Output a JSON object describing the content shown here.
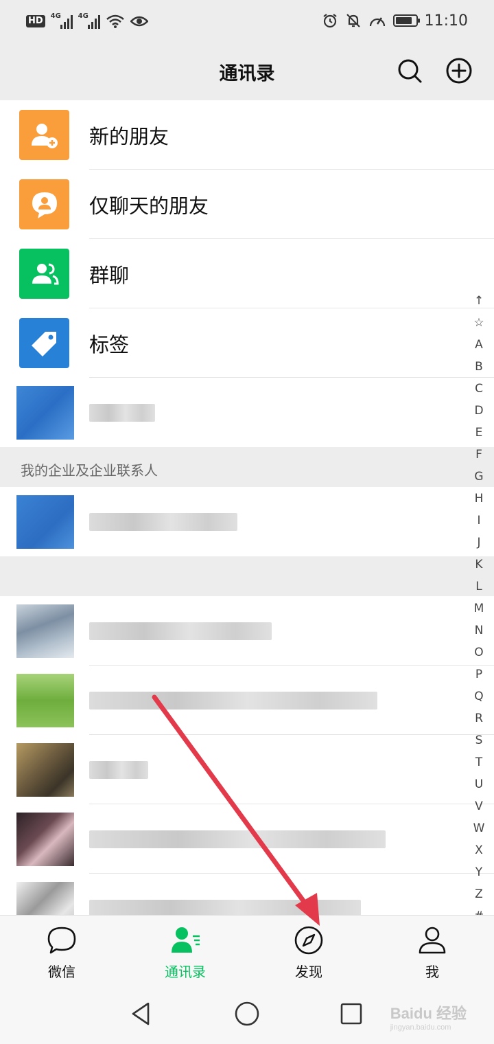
{
  "status_bar": {
    "hd": "HD",
    "network_1": "4G",
    "network_2": "4G",
    "time": "11:10",
    "battery_level": 0.85
  },
  "header": {
    "title": "通讯录",
    "search_icon": "search-icon",
    "add_icon": "plus-circle-icon"
  },
  "fixed_items": [
    {
      "label": "新的朋友",
      "icon": "person-add-icon",
      "color": "#fa9d3b"
    },
    {
      "label": "仅聊天的朋友",
      "icon": "chat-person-icon",
      "color": "#fa9d3b"
    },
    {
      "label": "群聊",
      "icon": "group-icon",
      "color": "#07c160"
    },
    {
      "label": "标签",
      "icon": "tag-icon",
      "color": "#2782d7"
    }
  ],
  "section_enterprise": "我的企业及企业联系人",
  "index_letters": [
    "↑",
    "☆",
    "A",
    "B",
    "C",
    "D",
    "E",
    "F",
    "G",
    "H",
    "I",
    "J",
    "K",
    "L",
    "M",
    "N",
    "O",
    "P",
    "Q",
    "R",
    "S",
    "T",
    "U",
    "V",
    "W",
    "X",
    "Y",
    "Z",
    "#"
  ],
  "tabs": [
    {
      "label": "微信",
      "icon": "chat-bubble-icon"
    },
    {
      "label": "通讯录",
      "icon": "contacts-icon",
      "active": true
    },
    {
      "label": "发现",
      "icon": "compass-icon"
    },
    {
      "label": "我",
      "icon": "person-icon"
    }
  ],
  "watermark": {
    "main": "Baidu 经验",
    "sub": "jingyan.baidu.com"
  },
  "colors": {
    "accent": "#07c160",
    "arrow": "#e23a4a"
  }
}
